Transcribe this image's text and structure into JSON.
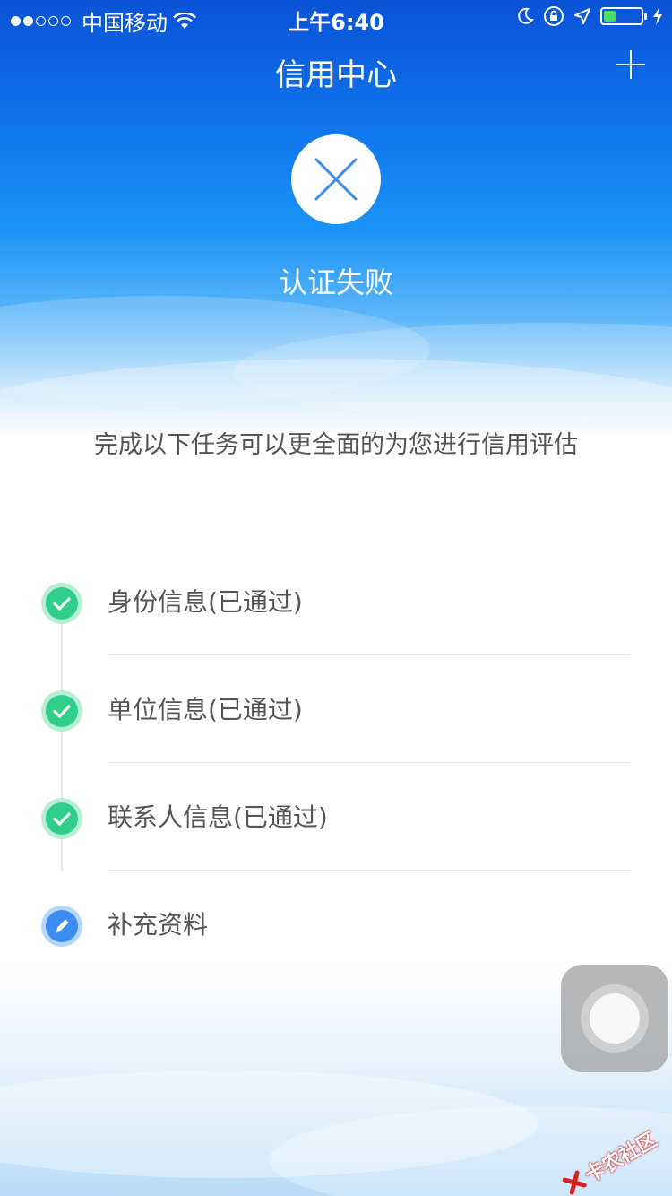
{
  "status_bar": {
    "carrier": "中国移动",
    "time": "上午6:40"
  },
  "nav": {
    "title": "信用中心",
    "add_icon": "plus-icon"
  },
  "result": {
    "icon": "close-icon",
    "text": "认证失败"
  },
  "subtitle": "完成以下任务可以更全面的为您进行信用评估",
  "tasks": [
    {
      "label": "身份信息(已通过)",
      "status": "passed",
      "icon": "check-icon"
    },
    {
      "label": "单位信息(已通过)",
      "status": "passed",
      "icon": "check-icon"
    },
    {
      "label": "联系人信息(已通过)",
      "status": "passed",
      "icon": "check-icon"
    },
    {
      "label": "补充资料",
      "status": "pending",
      "icon": "edit-icon"
    }
  ],
  "watermark": {
    "text": "卡农社区"
  },
  "colors": {
    "header_blue": "#0f74ec",
    "check_green": "#2fcf8a",
    "edit_blue": "#3d8df0",
    "fail_x": "#3d8de8"
  }
}
